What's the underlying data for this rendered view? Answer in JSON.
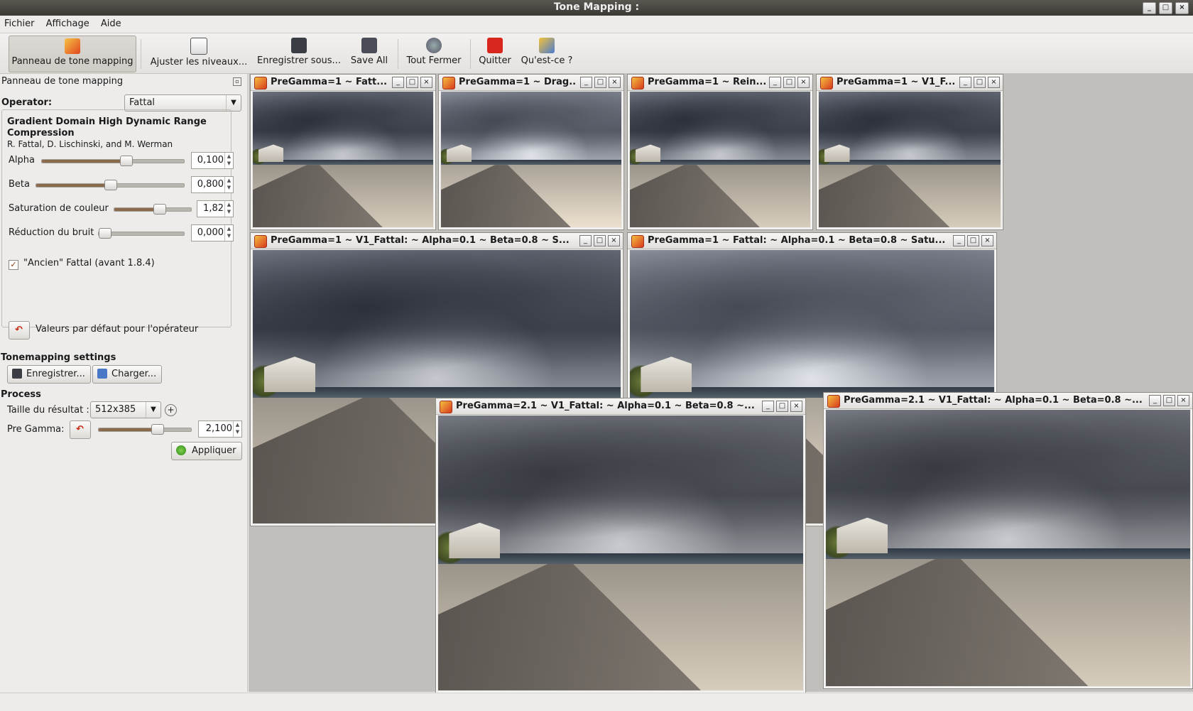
{
  "window": {
    "title": "Tone Mapping :"
  },
  "menu": [
    "Fichier",
    "Affichage",
    "Aide"
  ],
  "toolbar": {
    "tonemap_panel": "Panneau de tone mapping",
    "levels": "Ajuster les niveaux...",
    "save_as": "Enregistrer sous...",
    "save_all": "Save All",
    "close_all": "Tout Fermer",
    "quit": "Quitter",
    "whats_this": "Qu'est-ce ?"
  },
  "panel": {
    "header": "Panneau de tone mapping",
    "operator_label": "Operator:",
    "operator_value": "Fattal",
    "algo_title": "Gradient Domain High Dynamic Range Compression",
    "algo_authors": "R. Fattal, D. Lischinski, and M. Werman",
    "alpha": {
      "label": "Alpha",
      "value": "0,100",
      "level": 0.6
    },
    "beta": {
      "label": "Beta",
      "value": "0,800",
      "level": 0.5
    },
    "saturation": {
      "label": "Saturation de couleur",
      "value": "1,82",
      "level": 0.6
    },
    "noise": {
      "label": "Réduction du bruit",
      "value": "0,000",
      "level": 0.0
    },
    "old_fattal": {
      "label": "\"Ancien\" Fattal (avant 1.8.4)",
      "checked": true
    },
    "defaults_label": "Valeurs par défaut pour l'opérateur",
    "settings_title": "Tonemapping settings",
    "save_btn": "Enregistrer...",
    "load_btn": "Charger...",
    "process_title": "Process",
    "size_label": "Taille du résultat :",
    "size_value": "512x385",
    "pregamma_label": "Pre Gamma:",
    "pregamma_value": "2,100",
    "pregamma_level": 0.65,
    "apply_btn": "Appliquer"
  },
  "subwindows": [
    "PreGamma=1 ~ Fatt...",
    "PreGamma=1 ~ Drag...",
    "PreGamma=1 ~ Rein...",
    "PreGamma=1 ~ V1_F...",
    "PreGamma=1 ~ V1_Fattal: ~ Alpha=0.1 ~ Beta=0.8 ~ S...",
    "PreGamma=1 ~ Fattal: ~ Alpha=0.1 ~ Beta=0.8 ~ Satu...",
    "PreGamma=2.1 ~ V1_Fattal: ~ Alpha=0.1 ~ Beta=0.8 ~...",
    "PreGamma=2.1 ~ V1_Fattal: ~ Alpha=0.1 ~ Beta=0.8 ~..."
  ]
}
